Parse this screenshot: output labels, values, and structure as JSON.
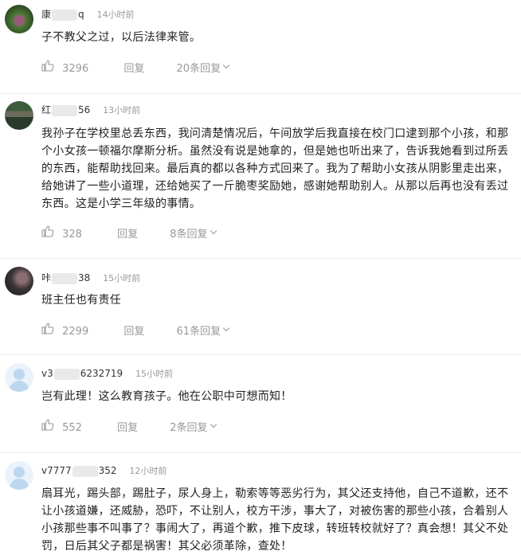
{
  "comments": [
    {
      "username_prefix": "康",
      "username_suffix": "q",
      "time": "14小时前",
      "text": "子不教父之过，以后法律来管。",
      "likes": "3296",
      "reply_label": "回复",
      "replies_label": "20条回复"
    },
    {
      "username_prefix": "红",
      "username_suffix": "56",
      "time": "13小时前",
      "text": "我孙子在学校里总丢东西，我问清楚情况后，午间放学后我直接在校门口逮到那个小孩，和那个小女孩一顿福尔摩斯分析。虽然没有说是她拿的，但是她也听出来了，告诉我她看到过所丢的东西，能帮助找回来。最后真的都以各种方式回来了。我为了帮助小女孩从阴影里走出来，给她讲了一些小道理，还给她买了一斤脆枣奖励她，感谢她帮助别人。从那以后再也没有丢过东西。这是小学三年级的事情。",
      "likes": "328",
      "reply_label": "回复",
      "replies_label": "8条回复"
    },
    {
      "username_prefix": "咔",
      "username_suffix": "38",
      "time": "15小时前",
      "text": "班主任也有责任",
      "likes": "2299",
      "reply_label": "回复",
      "replies_label": "61条回复"
    },
    {
      "username_prefix": "v3",
      "username_suffix": "6232719",
      "time": "15小时前",
      "text": "岂有此理！这么教育孩子。他在公职中可想而知！",
      "likes": "552",
      "reply_label": "回复",
      "replies_label": "2条回复"
    },
    {
      "username_prefix": "v7777",
      "username_suffix": "352",
      "time": "12小时前",
      "text": "扇耳光，踢头部，踢肚子，尿人身上，勒索等等恶劣行为，其父还支持他，自己不道歉，还不让小孩道嫌，还威胁，恐吓，不让别人，校方干涉，事大了，对被伤害的那些小孩，合着别人小孩那些事不叫事了？事闹大了，再道个歉，推下皮球，转班转校就好了？真会想！其父不处罚，日后其父子都是祸害！其父必须革除，查处！"
    }
  ],
  "icons": {
    "like": "thumbs-up-icon",
    "expand": "chevron-down-icon"
  }
}
